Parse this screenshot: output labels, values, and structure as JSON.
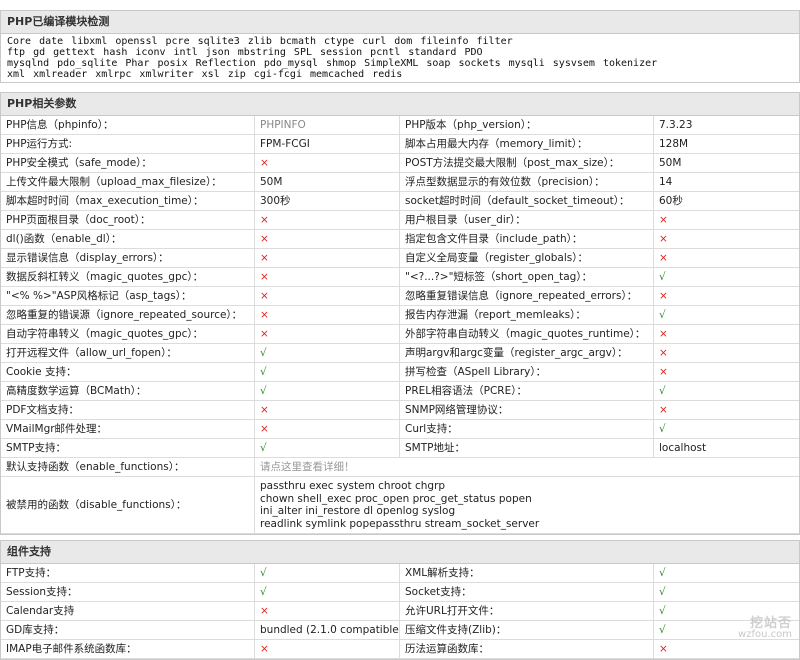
{
  "modules_section": {
    "title": "PHP已编译模块检测",
    "lines": [
      "Core  date  libxml  openssl  pcre  sqlite3  zlib  bcmath  ctype  curl  dom  fileinfo  filter",
      "ftp  gd  gettext  hash  iconv  intl  json  mbstring  SPL  session  pcntl  standard  PDO",
      "mysqlnd  pdo_sqlite  Phar  posix  Reflection  pdo_mysql  shmop  SimpleXML  soap  sockets  mysqli  sysvsem  tokenizer",
      "xml  xmlreader  xmlrpc  xmlwriter  xsl  zip  cgi-fcgi  memcached  redis"
    ]
  },
  "params_section": {
    "title": "PHP相关参数",
    "rows": [
      {
        "l1": "PHP信息（phpinfo）：",
        "v1": "PHPINFO",
        "v1cls": "gray",
        "l2": "PHP版本（php_version）：",
        "v2": "7.3.23",
        "v2cls": ""
      },
      {
        "l1": "PHP运行方式:",
        "v1": "FPM-FCGI",
        "v1cls": "",
        "l2": "脚本占用最大内存（memory_limit）：",
        "v2": "128M",
        "v2cls": ""
      },
      {
        "l1": "PHP安全模式（safe_mode）：",
        "v1": "×",
        "v1cls": "x",
        "l2": "POST方法提交最大限制（post_max_size）：",
        "v2": "50M",
        "v2cls": ""
      },
      {
        "l1": "上传文件最大限制（upload_max_filesize）：",
        "v1": "50M",
        "v1cls": "",
        "l2": "浮点型数据显示的有效位数（precision）：",
        "v2": "14",
        "v2cls": ""
      },
      {
        "l1": "脚本超时时间（max_execution_time）：",
        "v1": "300秒",
        "v1cls": "",
        "l2": "socket超时时间（default_socket_timeout）：",
        "v2": "60秒",
        "v2cls": ""
      },
      {
        "l1": "PHP页面根目录（doc_root）：",
        "v1": "×",
        "v1cls": "x",
        "l2": "用户根目录（user_dir）：",
        "v2": "×",
        "v2cls": "x"
      },
      {
        "l1": "dl()函数（enable_dl）：",
        "v1": "×",
        "v1cls": "x",
        "l2": "指定包含文件目录（include_path）：",
        "v2": "×",
        "v2cls": "x"
      },
      {
        "l1": "显示错误信息（display_errors）：",
        "v1": "×",
        "v1cls": "x",
        "l2": "自定义全局变量（register_globals）：",
        "v2": "×",
        "v2cls": "x"
      },
      {
        "l1": "数据反斜杠转义（magic_quotes_gpc）：",
        "v1": "×",
        "v1cls": "x",
        "l2": "\"<?...?>\"短标签（short_open_tag）：",
        "v2": "√",
        "v2cls": "ok"
      },
      {
        "l1": "\"<% %>\"ASP风格标记（asp_tags）：",
        "v1": "×",
        "v1cls": "x",
        "l2": "忽略重复错误信息（ignore_repeated_errors）：",
        "v2": "×",
        "v2cls": "x"
      },
      {
        "l1": "忽略重复的错误源（ignore_repeated_source）：",
        "v1": "×",
        "v1cls": "x",
        "l2": "报告内存泄漏（report_memleaks）：",
        "v2": "√",
        "v2cls": "ok"
      },
      {
        "l1": "自动字符串转义（magic_quotes_gpc）：",
        "v1": "×",
        "v1cls": "x",
        "l2": "外部字符串自动转义（magic_quotes_runtime）：",
        "v2": "×",
        "v2cls": "x"
      },
      {
        "l1": "打开远程文件（allow_url_fopen）：",
        "v1": "√",
        "v1cls": "ok",
        "l2": "声明argv和argc变量（register_argc_argv）：",
        "v2": "×",
        "v2cls": "x"
      },
      {
        "l1": "Cookie 支持：",
        "v1": "√",
        "v1cls": "ok",
        "l2": "拼写检查（ASpell Library）：",
        "v2": "×",
        "v2cls": "x"
      },
      {
        "l1": "高精度数学运算（BCMath）：",
        "v1": "√",
        "v1cls": "ok",
        "l2": "PREL相容语法（PCRE）：",
        "v2": "√",
        "v2cls": "ok"
      },
      {
        "l1": "PDF文档支持：",
        "v1": "×",
        "v1cls": "x",
        "l2": "SNMP网络管理协议：",
        "v2": "×",
        "v2cls": "x"
      },
      {
        "l1": "VMailMgr邮件处理：",
        "v1": "×",
        "v1cls": "x",
        "l2": "Curl支持：",
        "v2": "√",
        "v2cls": "ok"
      },
      {
        "l1": "SMTP支持：",
        "v1": "√",
        "v1cls": "ok",
        "l2": "SMTP地址：",
        "v2": "localhost",
        "v2cls": ""
      }
    ],
    "enable_functions": {
      "label": "默认支持函数（enable_functions）：",
      "value": "请点这里查看详细！"
    },
    "disable_functions": {
      "label": "被禁用的函数（disable_functions）：",
      "lines": [
        "passthru  exec  system  chroot  chgrp",
        "chown  shell_exec  proc_open  proc_get_status  popen",
        "ini_alter  ini_restore  dl  openlog  syslog",
        "readlink  symlink  popepassthru  stream_socket_server"
      ]
    }
  },
  "components_section": {
    "title": "组件支持",
    "rows": [
      {
        "l1": "FTP支持：",
        "v1": "√",
        "v1cls": "ok",
        "l2": "XML解析支持：",
        "v2": "√",
        "v2cls": "ok"
      },
      {
        "l1": "Session支持：",
        "v1": "√",
        "v1cls": "ok",
        "l2": "Socket支持：",
        "v2": "√",
        "v2cls": "ok"
      },
      {
        "l1": "Calendar支持",
        "v1": "×",
        "v1cls": "x",
        "l2": "允许URL打开文件：",
        "v2": "√",
        "v2cls": "ok"
      },
      {
        "l1": "GD库支持：",
        "v1": "bundled (2.1.0 compatible)",
        "v1cls": "",
        "l2": "压缩文件支持(Zlib)：",
        "v2": "√",
        "v2cls": "ok"
      },
      {
        "l1": "IMAP电子邮件系统函数库：",
        "v1": "×",
        "v1cls": "x",
        "l2": "历法运算函数库：",
        "v2": "×",
        "v2cls": "x"
      }
    ]
  },
  "watermark": {
    "big": "挖站否",
    "small": "wzfou.com"
  }
}
